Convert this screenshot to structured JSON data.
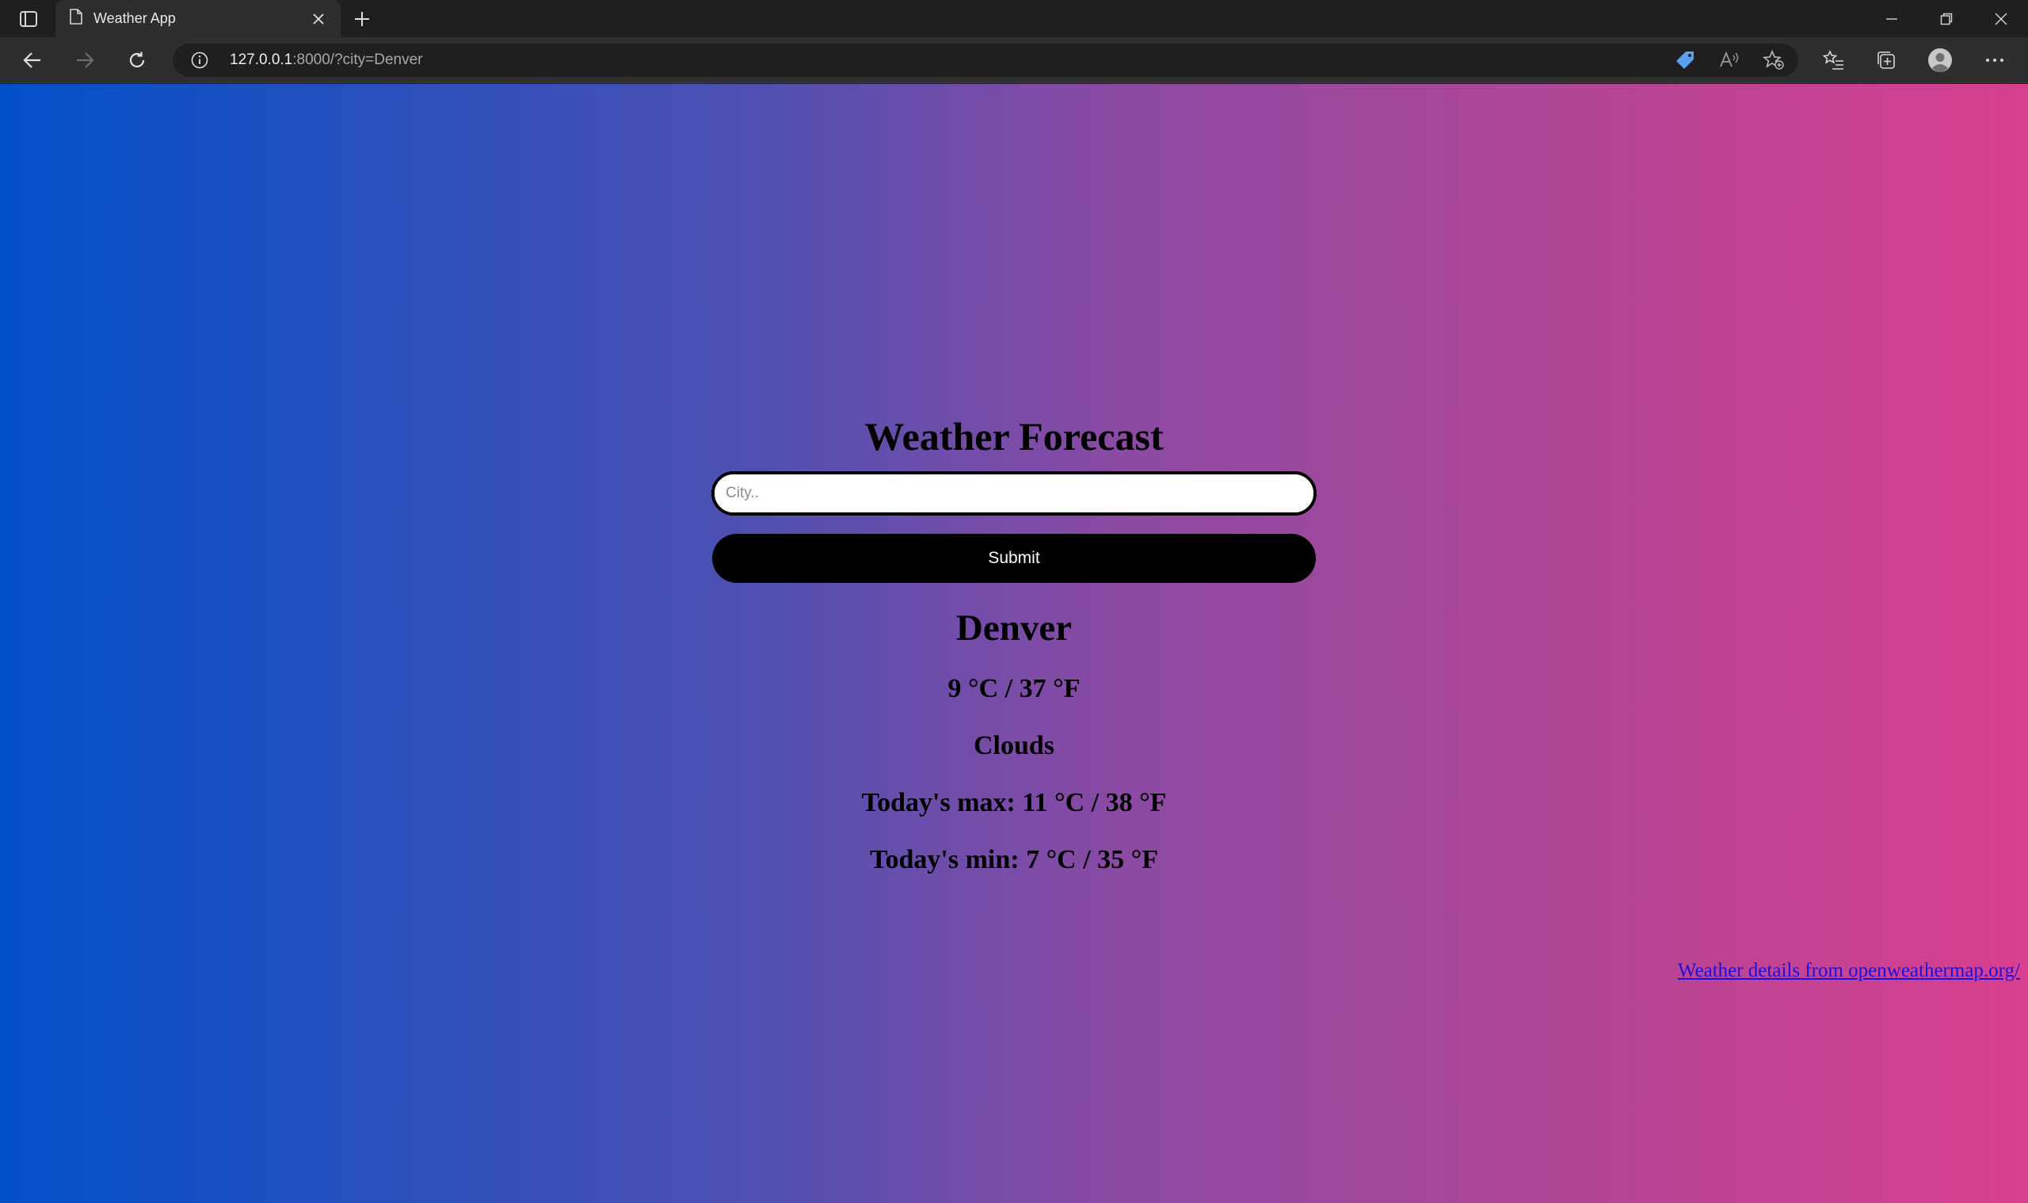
{
  "browser": {
    "tab_title": "Weather App",
    "url_host": "127.0.0.1",
    "url_path": ":8000/?city=Denver"
  },
  "page": {
    "heading": "Weather Forecast",
    "search": {
      "placeholder": "City..",
      "value": ""
    },
    "submit_label": "Submit",
    "city": "Denver",
    "current_temp": "9 °C / 37 °F",
    "condition": "Clouds",
    "today_max": "Today's max: 11 °C / 38 °F",
    "today_min": "Today's min: 7 °C / 35 °F",
    "credit_link": "Weather details from openweathermap.org/"
  },
  "colors": {
    "gradient_left": "#0150c9",
    "gradient_right": "#d83f8f",
    "button_bg": "#000000",
    "link": "#1f0edb"
  }
}
